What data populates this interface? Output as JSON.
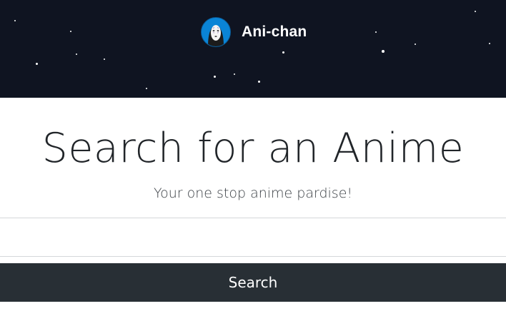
{
  "header": {
    "brand_name": "Ani-chan",
    "logo_icon": "no-face-mask-icon",
    "background_color": "#0f1421",
    "logo_color": "#0a84d6"
  },
  "main": {
    "title": "Search for an Anime",
    "subtitle": "Your one stop anime pardise!",
    "search": {
      "value": "",
      "placeholder": ""
    },
    "search_button_label": "Search",
    "button_color": "#282f35"
  }
}
